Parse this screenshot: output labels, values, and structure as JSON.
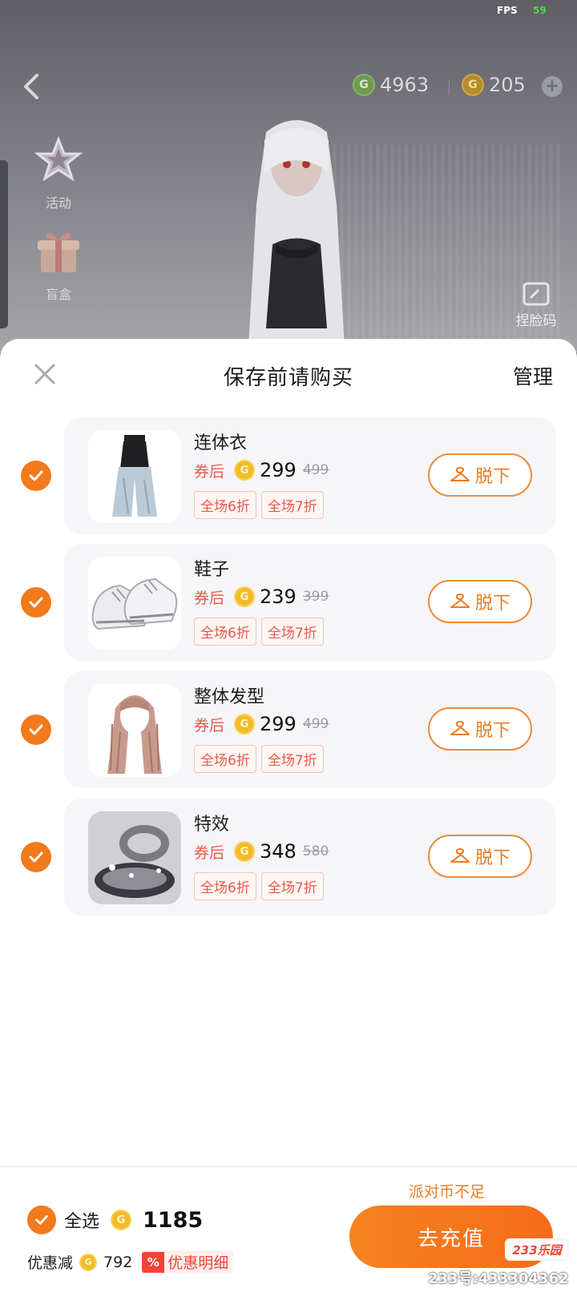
{
  "status": {
    "fps_label": "FPS",
    "fps_value": "59"
  },
  "topbar": {
    "currency_green": {
      "icon": "green-coin-icon",
      "value": "4963"
    },
    "currency_gold": {
      "icon": "gold-coin-icon",
      "value": "205"
    }
  },
  "side_menu": [
    {
      "label": "活动",
      "icon": "star-event-icon"
    },
    {
      "label": "盲盒",
      "icon": "gift-box-icon"
    }
  ],
  "face_code": {
    "label": "捏脸码"
  },
  "sheet": {
    "title": "保存前请购买",
    "manage_label": "管理",
    "items": [
      {
        "name": "连体衣",
        "after_coupon_label": "券后",
        "price": "299",
        "original_price": "499",
        "tags": [
          "全场6折",
          "全场7折"
        ],
        "takeoff_label": "脱下",
        "checked": true
      },
      {
        "name": "鞋子",
        "after_coupon_label": "券后",
        "price": "239",
        "original_price": "399",
        "tags": [
          "全场6折",
          "全场7折"
        ],
        "takeoff_label": "脱下",
        "checked": true
      },
      {
        "name": "整体发型",
        "after_coupon_label": "券后",
        "price": "299",
        "original_price": "499",
        "tags": [
          "全场6折",
          "全场7折"
        ],
        "takeoff_label": "脱下",
        "checked": true
      },
      {
        "name": "特效",
        "after_coupon_label": "券后",
        "price": "348",
        "original_price": "580",
        "tags": [
          "全场6折",
          "全场7折"
        ],
        "takeoff_label": "脱下",
        "checked": true
      }
    ]
  },
  "footer": {
    "insufficient_notice": "派对币不足",
    "select_all_label": "全选",
    "total": "1185",
    "discount_label": "优惠减",
    "discount_amount": "792",
    "detail_badge": "%",
    "detail_label": "优惠明细",
    "recharge_label": "去充值"
  },
  "watermark": {
    "badge": "233乐园",
    "text": "233号:433304362"
  },
  "colors": {
    "accent": "#F27A1A",
    "coupon_red": "#E8584C",
    "coin_gold": "#F2BB28"
  }
}
